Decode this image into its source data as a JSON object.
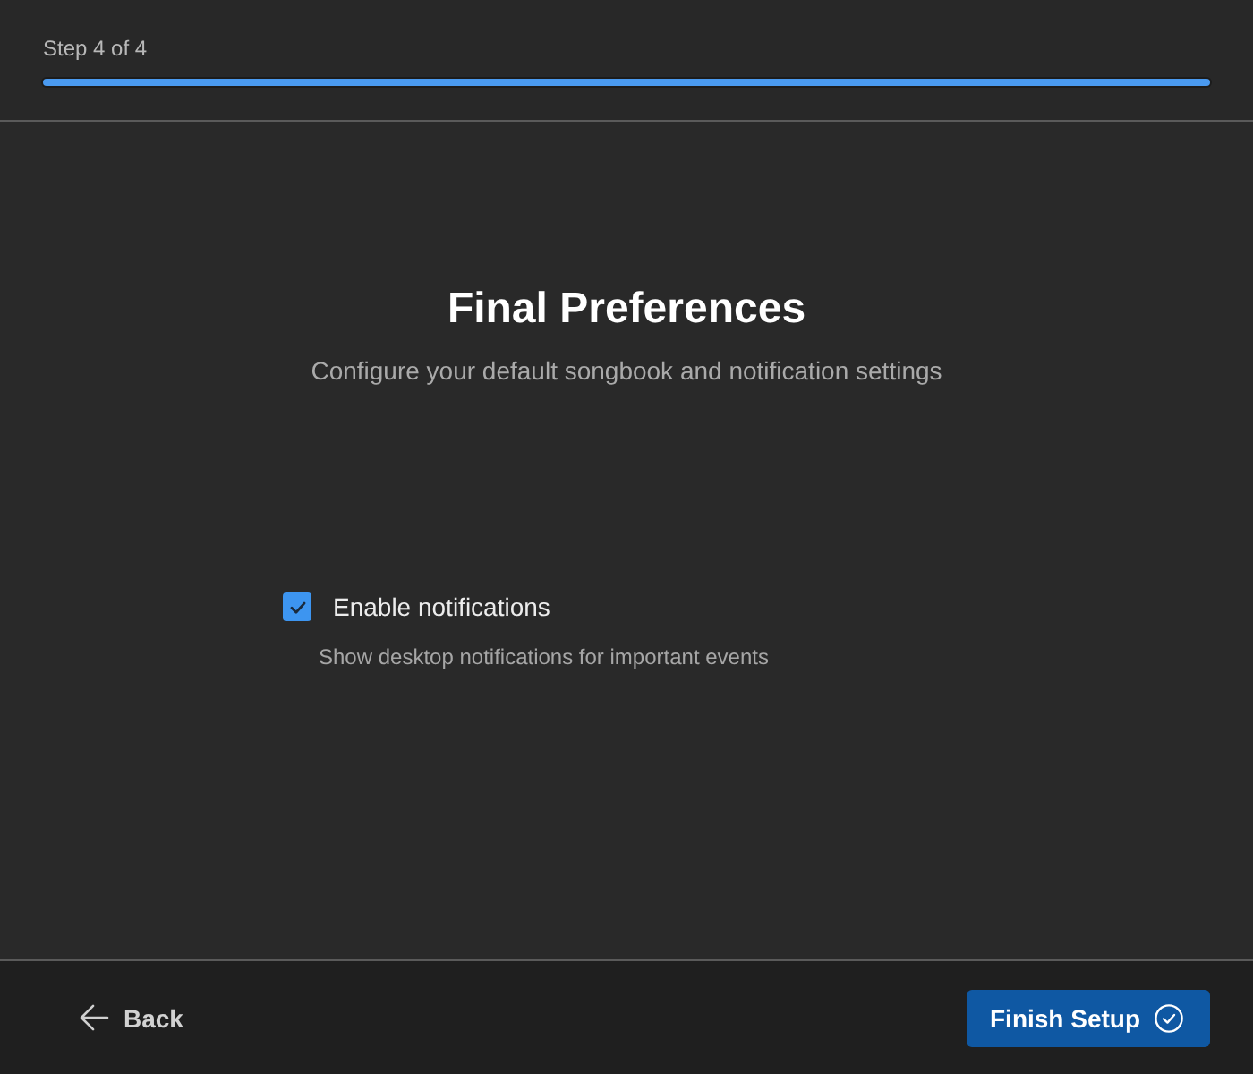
{
  "header": {
    "step_label": "Step 4 of 4",
    "progress": {
      "level": 1
    }
  },
  "title": "Final Preferences",
  "subtitle": "Configure your default songbook and notification settings",
  "options": [
    {
      "kind": "checkbox",
      "label": "Enable notifications",
      "description": "Show desktop notifications for important events",
      "checked": true
    }
  ],
  "footer": {
    "back_button": "Back",
    "finish_button": "Finish Setup"
  }
}
